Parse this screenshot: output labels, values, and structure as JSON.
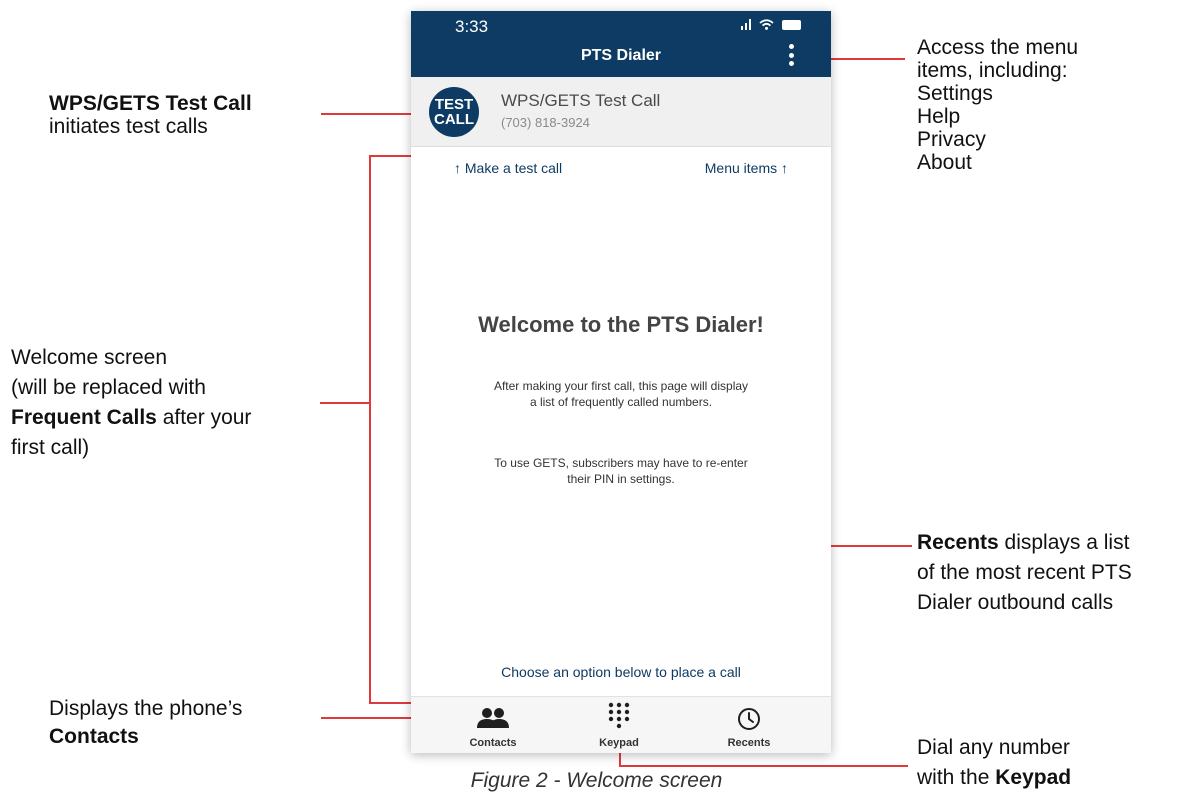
{
  "phone": {
    "status_time": "3:33",
    "app_title": "PTS Dialer",
    "test_call": {
      "badge_line1": "TEST",
      "badge_line2": "CALL",
      "name": "WPS/GETS Test Call",
      "number": "(703) 818-3924"
    },
    "hint_left": "↑  Make a test call",
    "hint_right": "Menu items  ↑",
    "welcome_title": "Welcome to the PTS Dialer!",
    "welcome_line1": "After making your first call, this page will display",
    "welcome_line2": "a list of frequently called numbers.",
    "gets_line1": "To use GETS, subscribers may have to  re-enter",
    "gets_line2": "their PIN in settings.",
    "choose_option": "Choose an option below to place a call",
    "tabs": [
      {
        "label": "Contacts",
        "icon": "contacts-icon"
      },
      {
        "label": "Keypad",
        "icon": "keypad-icon"
      },
      {
        "label": "Recents",
        "icon": "clock-icon"
      }
    ]
  },
  "annotations": {
    "test_call_bold": "WPS/GETS Test Call",
    "test_call_rest": "initiates test calls",
    "menu_intro_1": "Access the menu",
    "menu_intro_2": "items, including:",
    "menu_items": [
      "Settings",
      "Help",
      "Privacy",
      "About"
    ],
    "welcome_1": "Welcome screen",
    "welcome_2": "(will be replaced with",
    "welcome_bold": "Frequent Calls",
    "welcome_3": " after your",
    "welcome_4": "first call)",
    "recents_bold": "Recents",
    "recents_1": " displays a list",
    "recents_2": "of the most recent PTS",
    "recents_3": "Dialer outbound calls",
    "contacts_1": "Displays the phone’s",
    "contacts_bold": "Contacts",
    "keypad_1": "Dial any number",
    "keypad_2": "with the ",
    "keypad_bold": "Keypad"
  },
  "caption": "Figure 2 - Welcome screen",
  "colors": {
    "brand_navy": "#0e3b63",
    "callout_line": "#e0393b"
  }
}
